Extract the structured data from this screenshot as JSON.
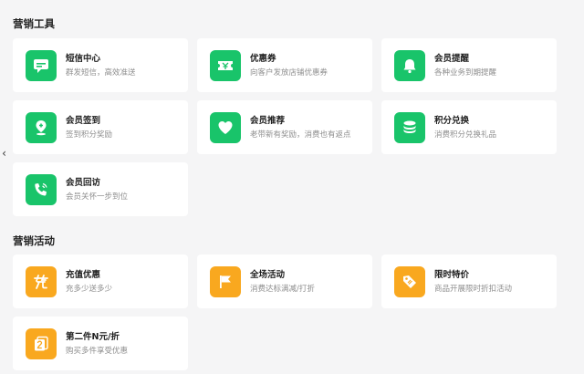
{
  "sections": [
    {
      "title": "营销工具",
      "items": [
        {
          "title": "短信中心",
          "desc": "群发短信，高效准送",
          "icon": "message-icon"
        },
        {
          "title": "优惠券",
          "desc": "向客户发放店铺优惠券",
          "icon": "coupon-icon"
        },
        {
          "title": "会员提醒",
          "desc": "各种业务到期提醒",
          "icon": "bell-icon"
        },
        {
          "title": "会员签到",
          "desc": "签到积分奖励",
          "icon": "location-checkin-icon"
        },
        {
          "title": "会员推荐",
          "desc": "老带新有奖励，消费也有返点",
          "icon": "heart-icon"
        },
        {
          "title": "积分兑换",
          "desc": "消费积分兑换礼品",
          "icon": "coin-stack-icon"
        },
        {
          "title": "会员回访",
          "desc": "会员关怀一步到位",
          "icon": "phone-icon"
        }
      ]
    },
    {
      "title": "营销活动",
      "items": [
        {
          "title": "充值优惠",
          "desc": "充多少送多少",
          "icon": "recharge-icon"
        },
        {
          "title": "全场活动",
          "desc": "消费达标满减/打折",
          "icon": "flag-icon"
        },
        {
          "title": "限时特价",
          "desc": "商品开展限时折扣活动",
          "icon": "price-tag-icon"
        },
        {
          "title": "第二件N元/折",
          "desc": "购买多件享受优惠",
          "icon": "second-item-icon"
        }
      ]
    }
  ],
  "colors": {
    "tools_accent": "#19c46a",
    "activity_accent": "#f9a81f"
  },
  "collapse_glyph": "‹"
}
